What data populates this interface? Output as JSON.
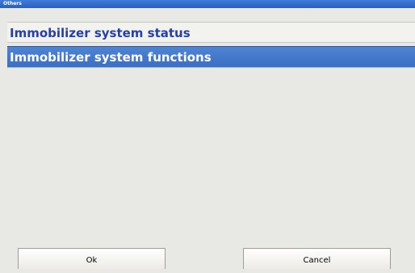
{
  "window": {
    "title": "Others"
  },
  "menu": {
    "items": [
      {
        "label": "Immobilizer system status",
        "selected": false
      },
      {
        "label": "Immobilizer system functions",
        "selected": true
      }
    ]
  },
  "buttons": {
    "ok_label": "Ok",
    "cancel_label": "Cancel"
  },
  "colors": {
    "title_bar": "#2a5fc0",
    "selected_item_bg": "#3a6fc2",
    "item_text": "#2640a8",
    "background": "#e8e8e4"
  }
}
